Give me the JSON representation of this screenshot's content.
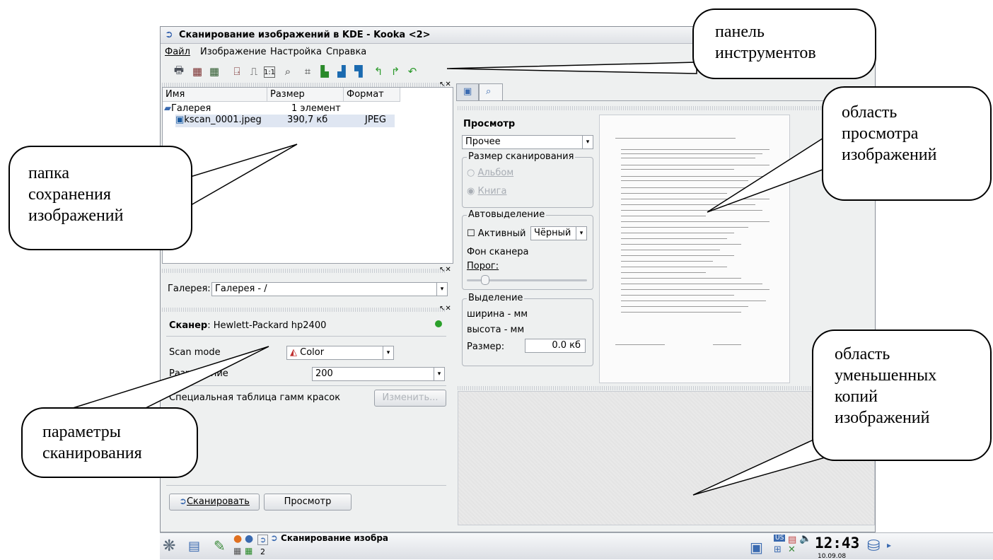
{
  "window": {
    "title": "Сканирование изображений в KDE - Kooka <2>",
    "menu": [
      "Файл",
      "Изображение",
      "Настройка",
      "Справка"
    ],
    "toolbar_icons": [
      "print-icon",
      "scan-icon",
      "scan-preview-icon",
      "page-icon",
      "page2-icon",
      "actual-size-icon",
      "zoom-icon",
      "crop-icon",
      "mirror-vertical-icon",
      "mirror-horizontal-icon",
      "mirror-both-icon",
      "rotate-left-icon",
      "rotate-right-icon",
      "rotate-180-icon"
    ]
  },
  "gallery": {
    "columns": [
      "Имя",
      "Размер",
      "Формат"
    ],
    "root": {
      "name": "Галерея",
      "size": "1 элемент"
    },
    "file": {
      "name": "kscan_0001.jpeg",
      "size": "390,7 кб",
      "format": "JPEG"
    },
    "folder_label": "Галерея:",
    "folder_value": "Галерея - /"
  },
  "scanner": {
    "label": "Сканер",
    "name": ": Hewlett-Packard hp2400",
    "scan_mode_label": "Scan mode",
    "scan_mode_value": "Color",
    "resolution_label": "Разрешение",
    "resolution_value": "200",
    "gamma_label": "Специальная таблица гамм красок",
    "edit_button": "Изменить...",
    "scan_button": "Сканировать",
    "preview_button": "Просмотр"
  },
  "preview": {
    "heading": "Просмотр",
    "preset": "Прочее",
    "scan_size_title": "Размер сканирования",
    "option_album": "Альбом",
    "option_book": "Книга",
    "auto_select_title": "Автовыделение",
    "active_label": "Активный",
    "color_value": "Чёрный",
    "background_label": "Фон сканера",
    "threshold_label": "Порог:",
    "selection_title": "Выделение",
    "width_text": "ширина - мм",
    "height_text": "высота - мм",
    "size_label": "Размер:",
    "size_value": "0.0 кб"
  },
  "taskbar": {
    "task_label": "Сканирование изобра",
    "desktop_num": "2",
    "clock": "12:43",
    "date": "10.09.08",
    "kbd": "US"
  },
  "callouts": {
    "toolbar": [
      "панель",
      "инструментов"
    ],
    "preview": [
      "область",
      "просмотра",
      "изображений"
    ],
    "folder": [
      "папка",
      "сохранения",
      "изображений"
    ],
    "params": [
      "параметры",
      "сканирования"
    ],
    "thumbs": [
      "область",
      "уменьшенных",
      "копий",
      "изображений"
    ]
  }
}
